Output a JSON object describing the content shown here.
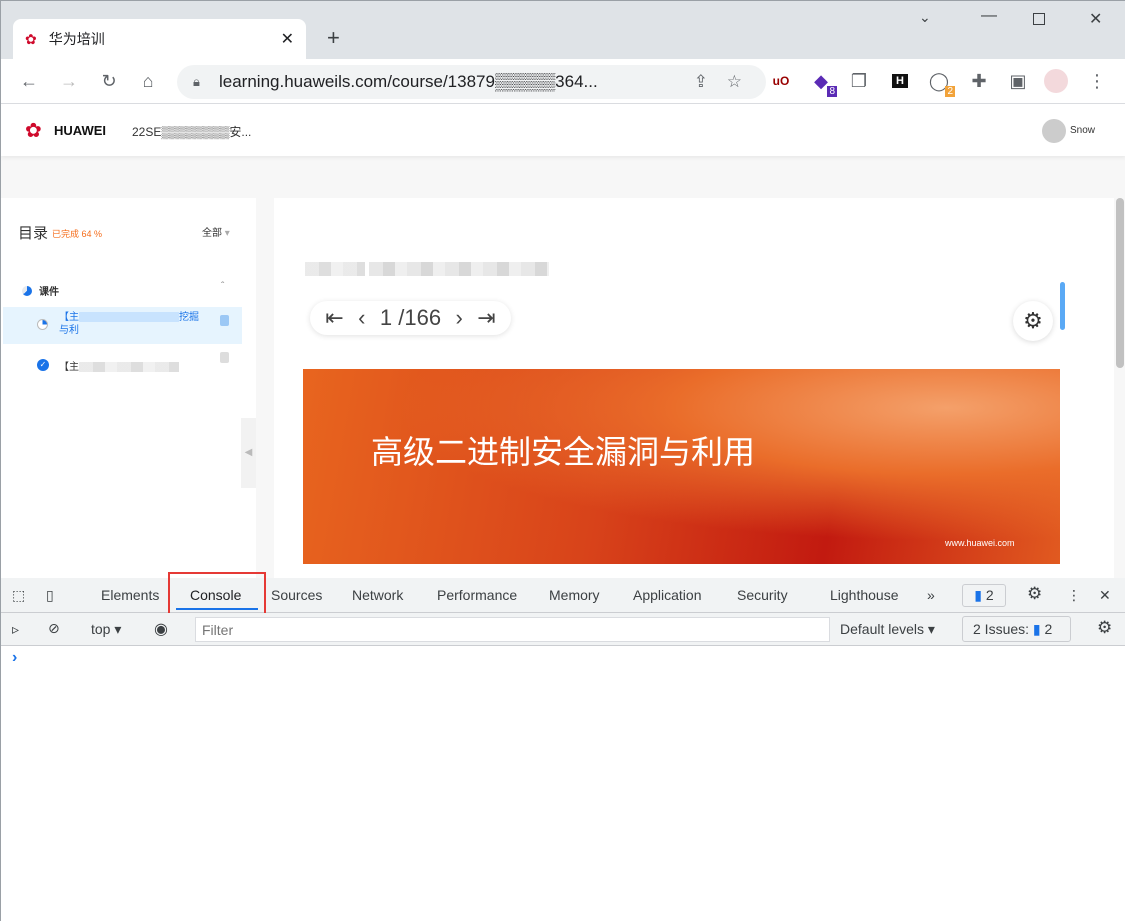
{
  "browser": {
    "tab_title": "华为培训",
    "url": "learning.huaweils.com/course/13879▒▒▒▒▒364...",
    "ext_badges": {
      "purple": "8",
      "gray": "2"
    },
    "ext_h": "H",
    "ext_ub": "uO"
  },
  "site": {
    "brand": "HUAWEI",
    "course_title": "22SE▒▒▒▒▒▒▒▒安...",
    "user": "Snow"
  },
  "sidebar": {
    "title": "目录",
    "progress": "已完成 64 %",
    "filter": "全部",
    "section": "课件",
    "items": [
      {
        "label_start": "【‍主",
        "label_end": "挖掘",
        "label_line2": "与利"
      },
      {
        "label_start": "【主"
      }
    ]
  },
  "viewer": {
    "page": "1 /166",
    "slide_title": "高级二进制安全漏洞与利用",
    "slide_footer": "www.huawei.com"
  },
  "devtools": {
    "tabs": [
      "Elements",
      "Console",
      "Sources",
      "Network",
      "Performance",
      "Memory",
      "Application",
      "Security",
      "Lighthouse"
    ],
    "active_tab": "Console",
    "more": "»",
    "issues_badge": "2",
    "context": "top",
    "filter_placeholder": "Filter",
    "levels": "Default levels",
    "issues_label": "2 Issues:",
    "issues_count": "2",
    "prompt": "›"
  },
  "colors": {
    "accent": "#1a73e8",
    "huawei_red": "#cf0a2c",
    "progress_orange": "#f56c1a",
    "highlight_box": "#e53935"
  }
}
